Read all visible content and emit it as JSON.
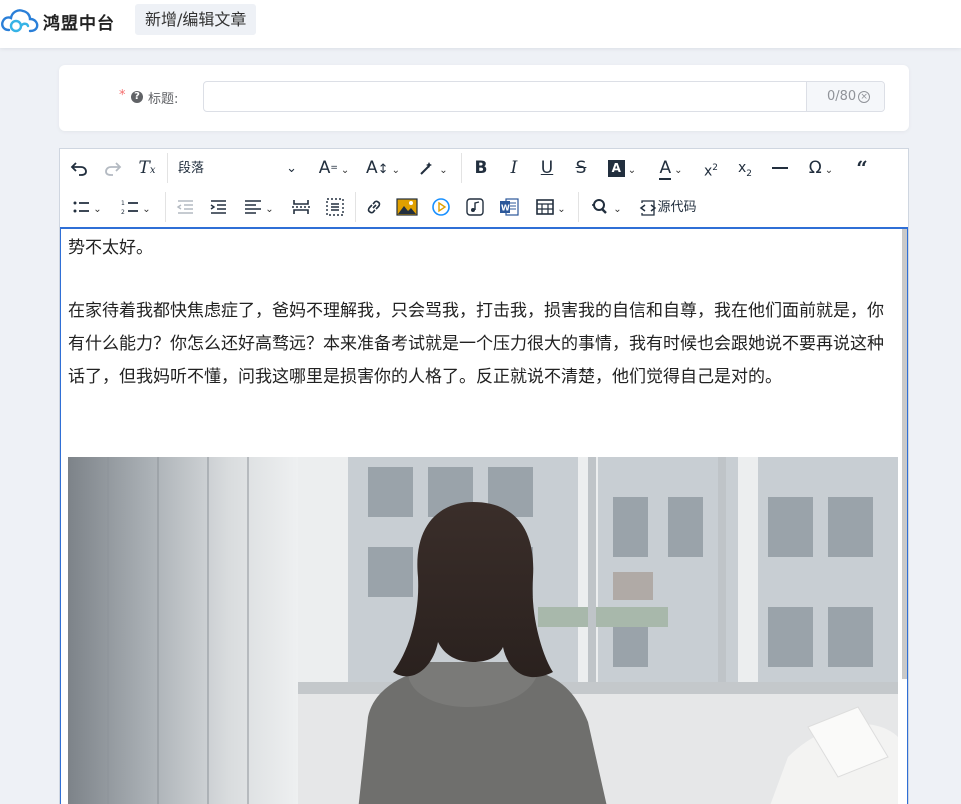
{
  "header": {
    "brand": "鸿盟中台",
    "page_tab": "新增/编辑文章"
  },
  "title_field": {
    "required_mark": "*",
    "label": "标题:",
    "value": "",
    "placeholder": "",
    "counter": "0/80"
  },
  "toolbar": {
    "row1": [
      {
        "icon": "undo-icon"
      },
      {
        "icon": "redo-icon",
        "disabled": true
      },
      {
        "icon": "clear-format-icon"
      },
      {
        "icon": "block-format-select",
        "label": "段落"
      },
      {
        "icon": "font-size-icon"
      },
      {
        "icon": "line-height-icon"
      },
      {
        "icon": "format-painter-icon"
      },
      {
        "icon": "bold-icon"
      },
      {
        "icon": "italic-icon"
      },
      {
        "icon": "underline-icon"
      },
      {
        "icon": "strikethrough-icon"
      },
      {
        "icon": "background-color-icon"
      },
      {
        "icon": "text-color-icon"
      },
      {
        "icon": "superscript-icon"
      },
      {
        "icon": "subscript-icon"
      },
      {
        "icon": "horizontal-rule-icon"
      },
      {
        "icon": "special-character-icon"
      },
      {
        "icon": "blockquote-icon"
      }
    ],
    "row2": [
      {
        "icon": "bullet-list-icon"
      },
      {
        "icon": "numbered-list-icon"
      },
      {
        "icon": "outdent-icon",
        "disabled": true
      },
      {
        "icon": "indent-icon"
      },
      {
        "icon": "align-icon"
      },
      {
        "icon": "page-break-icon"
      },
      {
        "icon": "select-all-icon"
      },
      {
        "icon": "link-icon"
      },
      {
        "icon": "image-icon"
      },
      {
        "icon": "video-icon"
      },
      {
        "icon": "audio-icon"
      },
      {
        "icon": "word-import-icon"
      },
      {
        "icon": "table-icon"
      },
      {
        "icon": "search-replace-icon"
      },
      {
        "icon": "source-code-icon",
        "label": "源代码"
      }
    ]
  },
  "content": {
    "paragraph_first": "势不太好。",
    "paragraph_main": "在家待着我都快焦虑症了，爸妈不理解我，只会骂我，打击我，损害我的自信和自尊，我在他们面前就是，你有什么能力？你怎么还好高骛远？本来准备考试就是一个压力很大的事情，我有时候也会跟她说不要再说这种话了，但我妈听不懂，问我这哪里是损害你的人格了。反正就说不清楚，他们觉得自己是对的。",
    "image": "photo-woman-hoodie-by-window"
  },
  "colors": {
    "required": "#f56c6c",
    "focus_border": "#2f6fd6",
    "word_blue": "#2b579a",
    "video_blue": "#1890ff",
    "image_gold": "#e0a000"
  }
}
